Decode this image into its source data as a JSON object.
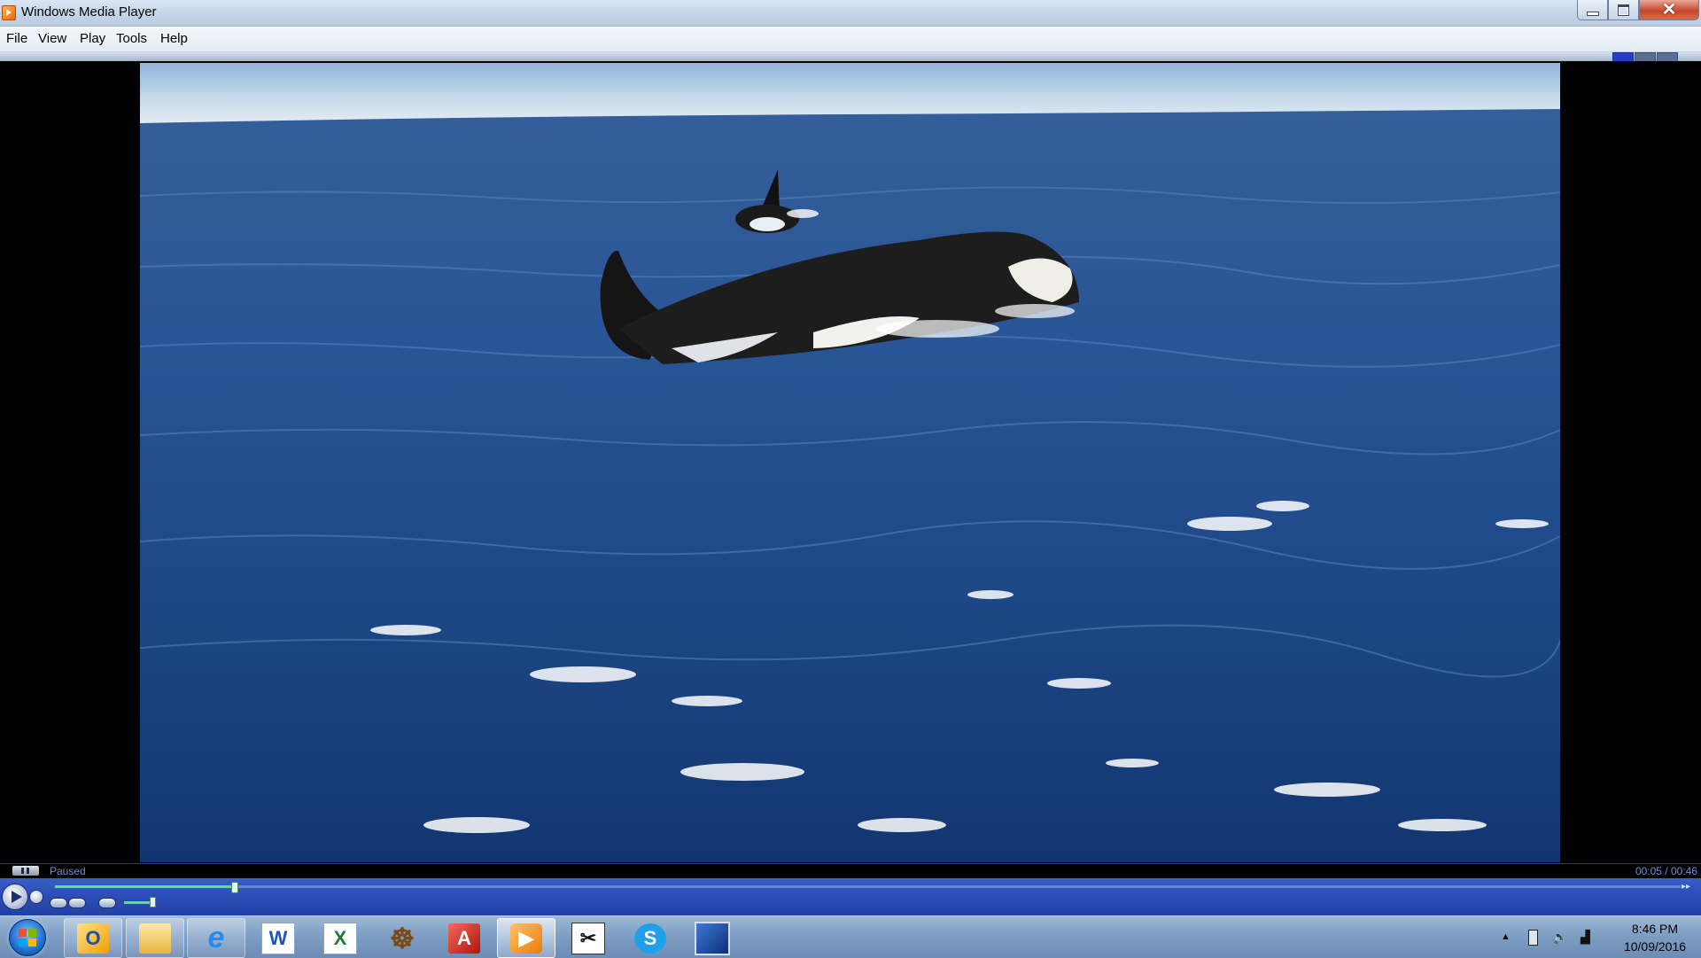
{
  "window": {
    "title": "Windows Media Player"
  },
  "menu": {
    "items": [
      "File",
      "View",
      "Play",
      "Tools",
      "Help"
    ]
  },
  "player": {
    "status": "Paused",
    "time_display": "00:05 / 00:46",
    "progress_fraction": 0.11,
    "volume_fraction": 0.85,
    "accent_color": "#5fe07a"
  },
  "taskbar": {
    "pinned": [
      {
        "name": "outlook-icon"
      },
      {
        "name": "file-explorer-icon"
      },
      {
        "name": "internet-explorer-icon"
      },
      {
        "name": "word-icon"
      },
      {
        "name": "excel-icon"
      },
      {
        "name": "ship-wheel-icon"
      },
      {
        "name": "acrobat-icon"
      },
      {
        "name": "windows-media-player-icon"
      },
      {
        "name": "snipping-tool-icon"
      },
      {
        "name": "skype-icon"
      },
      {
        "name": "remote-desktop-icon"
      }
    ],
    "clock_time": "8:46 PM",
    "clock_date": "10/09/2016"
  }
}
